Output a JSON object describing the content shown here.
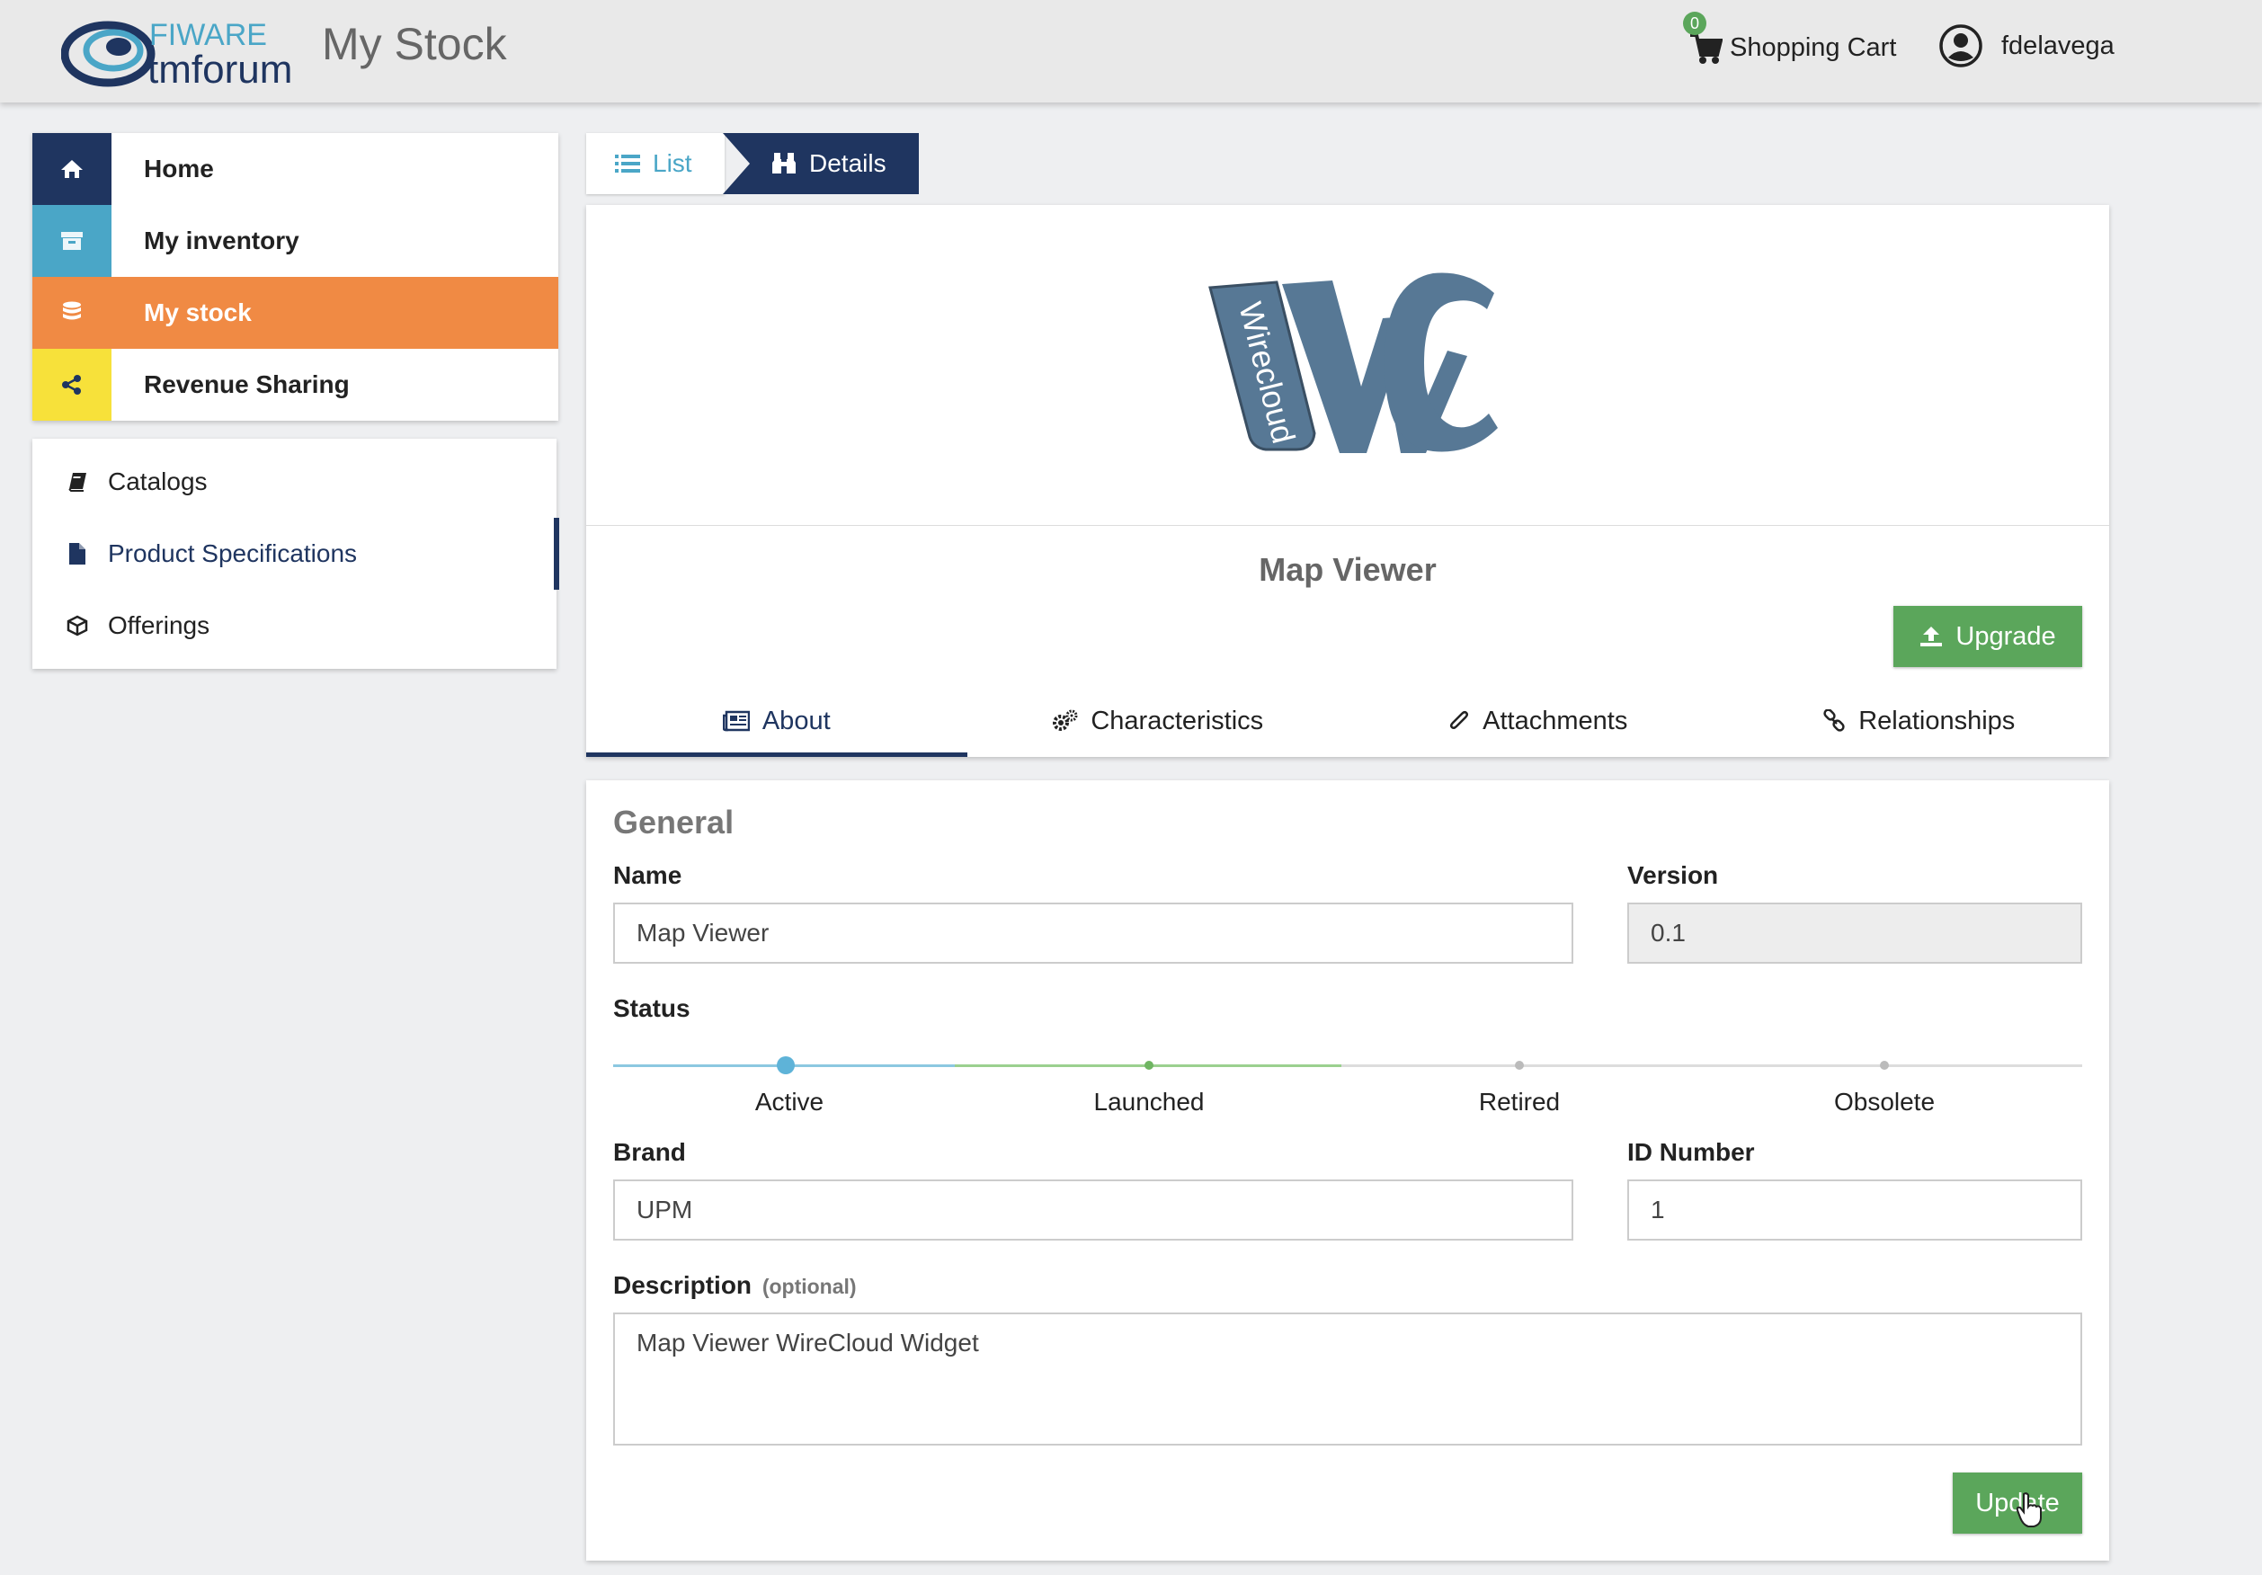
{
  "header": {
    "logo_text_top": "FIWARE",
    "logo_text_bottom": "tmforum",
    "app_title": "My Stock",
    "cart_count": "0",
    "cart_label": "Shopping Cart",
    "username": "fdelavega"
  },
  "sidebar": {
    "main": [
      {
        "label": "Home",
        "icon": "home-icon",
        "color": "#1f3560"
      },
      {
        "label": "My inventory",
        "icon": "archive-icon",
        "color": "#4aa6c7"
      },
      {
        "label": "My stock",
        "icon": "database-icon",
        "color": "#f08a44"
      },
      {
        "label": "Revenue Sharing",
        "icon": "share-icon",
        "color": "#f7e13a"
      }
    ],
    "sub": [
      {
        "label": "Catalogs",
        "icon": "book-icon"
      },
      {
        "label": "Product Specifications",
        "icon": "file-icon"
      },
      {
        "label": "Offerings",
        "icon": "cube-icon"
      }
    ]
  },
  "breadcrumb": {
    "list_label": "List",
    "details_label": "Details"
  },
  "product": {
    "logo_text": "Wirecloud",
    "name": "Map Viewer",
    "upgrade_label": "Upgrade"
  },
  "tabs": [
    {
      "label": "About",
      "icon": "newspaper-icon"
    },
    {
      "label": "Characteristics",
      "icon": "cogs-icon"
    },
    {
      "label": "Attachments",
      "icon": "paperclip-icon"
    },
    {
      "label": "Relationships",
      "icon": "link-icon"
    }
  ],
  "form": {
    "section_title": "General",
    "name_label": "Name",
    "name_value": "Map Viewer",
    "version_label": "Version",
    "version_value": "0.1",
    "status_label": "Status",
    "status_steps": [
      "Active",
      "Launched",
      "Retired",
      "Obsolete"
    ],
    "status_current": "Active",
    "brand_label": "Brand",
    "brand_value": "UPM",
    "id_label": "ID Number",
    "id_value": "1",
    "description_label": "Description",
    "description_optional": "(optional)",
    "description_value": "Map Viewer WireCloud Widget",
    "update_label": "Update"
  },
  "colors": {
    "primary": "#1f3560",
    "accent_blue": "#4aa6c7",
    "accent_orange": "#f08a44",
    "accent_yellow": "#f7e13a",
    "success": "#5ba65b"
  }
}
